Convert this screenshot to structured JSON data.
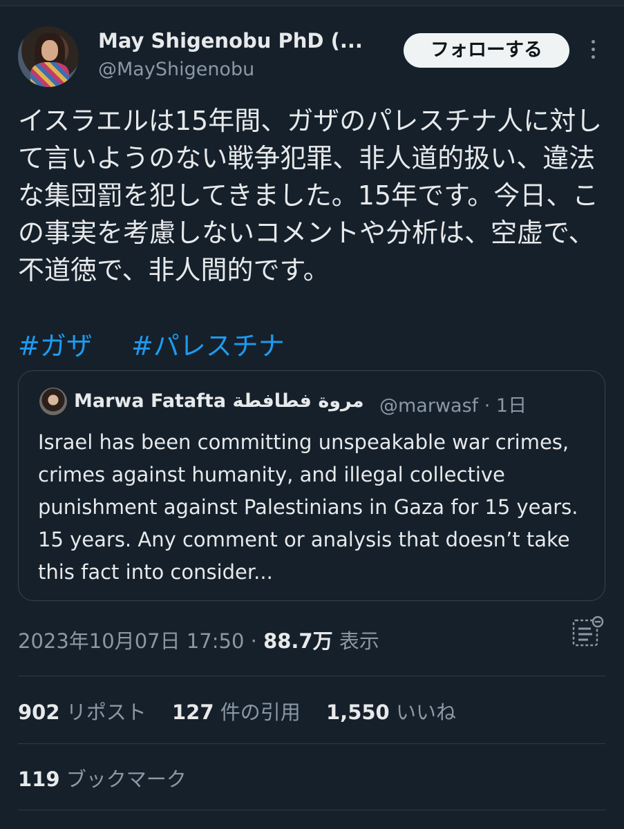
{
  "author": {
    "name": "May Shigenobu PhD (...",
    "handle": "@MayShigenobu"
  },
  "follow_button": "フォローする",
  "tweet": {
    "text": "イスラエルは15年間、ガザのパレスチナ人に対して言いようのない戦争犯罪、非人道的扱い、違法な集団罰を犯してきました。15年です。今日、この事実を考慮しないコメントや分析は、空虚で、不道徳で、非人間的です。",
    "hashtags": [
      "#ガザ",
      "#パレスチナ"
    ]
  },
  "quoted_tweet": {
    "name": "Marwa Fatafta مروة فطافطة",
    "handle_time": "@marwasf · 1日",
    "text": "Israel has been committing unspeakable war crimes, crimes against humanity, and illegal collective punishment against Palestinians in Gaza for 15 years. 15 years. Any comment or analysis that doesn’t take this fact into consider..."
  },
  "meta": {
    "timestamp": "2023年10月07日 17:50",
    "separator": "·",
    "views_count": "88.7万",
    "views_label": "表示"
  },
  "stats": {
    "reposts_count": "902",
    "reposts_label": "リポスト",
    "quotes_count": "127",
    "quotes_label": "件の引用",
    "likes_count": "1,550",
    "likes_label": "いいね",
    "bookmarks_count": "119",
    "bookmarks_label": "ブックマーク"
  },
  "colors": {
    "background": "#15202b",
    "text": "#e7e9ea",
    "secondary": "#8b98a5",
    "link": "#1d9bf0",
    "border": "#38444d"
  },
  "icons": [
    "more-icon",
    "analytics-icon"
  ]
}
